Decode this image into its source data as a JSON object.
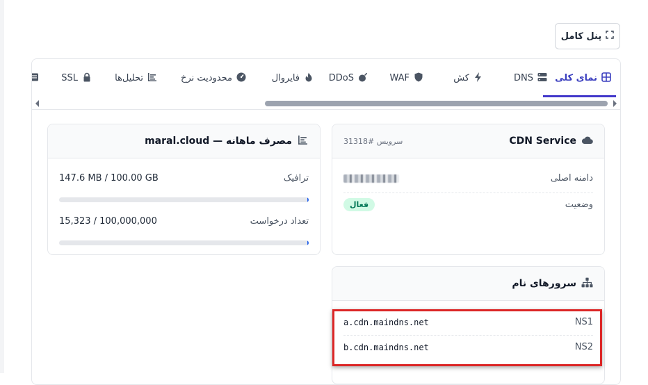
{
  "header": {
    "full_panel_label": "پنل کامل"
  },
  "tabs": [
    {
      "label": "نمای کلی",
      "icon": "grid-icon",
      "active": true
    },
    {
      "label": "DNS",
      "icon": "server-icon"
    },
    {
      "label": "کش",
      "icon": "bolt-icon"
    },
    {
      "label": "WAF",
      "icon": "shield-icon"
    },
    {
      "label": "DDoS",
      "icon": "bomb-icon"
    },
    {
      "label": "فایروال",
      "icon": "fire-icon"
    },
    {
      "label": "محدودیت نرخ",
      "icon": "gauge-icon"
    },
    {
      "label": "تحلیل‌ها",
      "icon": "chart-icon"
    },
    {
      "label": "SSL",
      "icon": "lock-icon"
    }
  ],
  "service_card": {
    "title": "CDN Service",
    "service_id": "سرویس #31318",
    "domain_label": "دامنه اصلی",
    "status_label": "وضعیت",
    "status_value": "فعال"
  },
  "usage_card": {
    "title": "مصرف ماهانه — maral.cloud",
    "traffic_label": "ترافیک",
    "traffic_value": "147.6 MB / 100.00 GB",
    "traffic_fraction": 0.0015,
    "requests_label": "تعداد درخواست",
    "requests_value": "15,323 / 100,000,000",
    "requests_fraction": 0.00015
  },
  "ns_card": {
    "title": "سرورهای نام",
    "rows": [
      {
        "label": "NS1",
        "value": "a.cdn.maindns.net"
      },
      {
        "label": "NS2",
        "value": "b.cdn.maindns.net"
      }
    ]
  },
  "colors": {
    "accent": "#4338ca",
    "status_green": "#047857",
    "highlight": "#dc2626"
  }
}
